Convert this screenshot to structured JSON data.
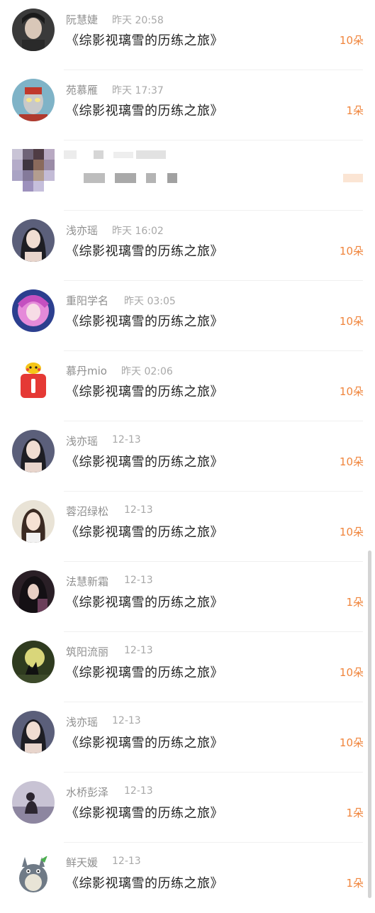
{
  "rows": [
    {
      "name": "阮慧婕",
      "time": "昨天 20:58",
      "message": "《综影视璃雪的历练之旅》",
      "count": "10朵",
      "avatar": "avatar-woman-dark-icon"
    },
    {
      "name": "苑慕雁",
      "time": "昨天 17:37",
      "message": "《综影视璃雪的历练之旅》",
      "count": "1朵",
      "avatar": "avatar-ultraman-icon"
    },
    {
      "redacted": true,
      "avatar": "avatar-pixelated-icon"
    },
    {
      "name": "浅亦瑶",
      "time": "昨天 16:02",
      "message": "《综影视璃雪的历练之旅》",
      "count": "10朵",
      "avatar": "avatar-woman-portrait-icon"
    },
    {
      "name": "重阳学名",
      "time": "昨天 03:05",
      "message": "《综影视璃雪的历练之旅》",
      "count": "10朵",
      "avatar": "avatar-anime-pink-icon"
    },
    {
      "name": "慕丹mio",
      "time": "昨天 02:06",
      "message": "《综影视璃雪的历练之旅》",
      "count": "10朵",
      "avatar": "avatar-pikachu-sticker-icon"
    },
    {
      "name": "浅亦瑶",
      "time": "12-13",
      "message": "《综影视璃雪的历练之旅》",
      "count": "10朵",
      "avatar": "avatar-woman-portrait-icon"
    },
    {
      "name": "蓉沼绿松",
      "time": "12-13",
      "message": "《综影视璃雪的历练之旅》",
      "count": "10朵",
      "avatar": "avatar-girl-light-icon"
    },
    {
      "name": "法慧新霜",
      "time": "12-13",
      "message": "《综影视璃雪的历练之旅》",
      "count": "1朵",
      "avatar": "avatar-anime-dark-hair-icon"
    },
    {
      "name": "筑阳流丽",
      "time": "12-13",
      "message": "《综影视璃雪的历练之旅》",
      "count": "10朵",
      "avatar": "avatar-wolf-moon-icon"
    },
    {
      "name": "浅亦瑶",
      "time": "12-13",
      "message": "《综影视璃雪的历练之旅》",
      "count": "10朵",
      "avatar": "avatar-woman-portrait-icon"
    },
    {
      "name": "水桥彭泽",
      "time": "12-13",
      "message": "《综影视璃雪的历练之旅》",
      "count": "1朵",
      "avatar": "avatar-sitting-figure-icon"
    },
    {
      "name": "鲜天媛",
      "time": "12-13",
      "message": "《综影视璃雪的历练之旅》",
      "count": "1朵",
      "avatar": "avatar-totoro-icon"
    }
  ],
  "colors": {
    "accent": "#f0853c",
    "name": "#8f8f8f",
    "time": "#a8a8a8",
    "message": "#222222"
  }
}
